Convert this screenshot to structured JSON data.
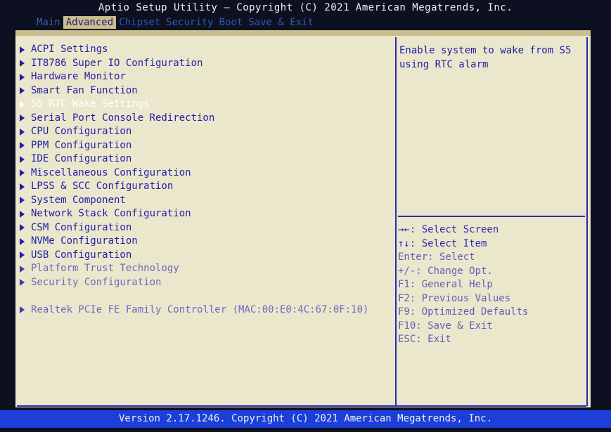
{
  "header": {
    "title": "Aptio Setup Utility – Copyright (C) 2021 American Megatrends, Inc."
  },
  "tabs": [
    {
      "label": "Main"
    },
    {
      "label": "Advanced",
      "active": true
    },
    {
      "label": "Chipset"
    },
    {
      "label": "Security"
    },
    {
      "label": "Boot"
    },
    {
      "label": "Save & Exit"
    }
  ],
  "menu": {
    "selected_index": 4,
    "items": [
      {
        "label": "ACPI Settings"
      },
      {
        "label": "IT8786 Super IO Configuration"
      },
      {
        "label": "Hardware Monitor"
      },
      {
        "label": "Smart Fan Function"
      },
      {
        "label": "S5 RTC Wake Settings"
      },
      {
        "label": "Serial Port Console Redirection"
      },
      {
        "label": "CPU Configuration"
      },
      {
        "label": "PPM Configuration"
      },
      {
        "label": "IDE Configuration"
      },
      {
        "label": "Miscellaneous Configuration"
      },
      {
        "label": "LPSS & SCC Configuration"
      },
      {
        "label": "System Component"
      },
      {
        "label": "Network Stack Configuration"
      },
      {
        "label": "CSM Configuration"
      },
      {
        "label": "NVMe Configuration"
      },
      {
        "label": "USB Configuration"
      },
      {
        "label": "Platform Trust Technology"
      },
      {
        "label": "Security Configuration"
      },
      {
        "label": "Realtek PCIe FE Family Controller (MAC:00:E0:4C:67:0F:10)"
      }
    ]
  },
  "help": {
    "text": "Enable system to wake from S5 using RTC alarm"
  },
  "keys": [
    {
      "label": "→←: Select Screen"
    },
    {
      "label": "↑↓: Select Item"
    },
    {
      "label": "Enter: Select"
    },
    {
      "label": "+/-: Change Opt."
    },
    {
      "label": "F1: General Help"
    },
    {
      "label": "F2: Previous Values"
    },
    {
      "label": "F9: Optimized Defaults"
    },
    {
      "label": "F10: Save & Exit"
    },
    {
      "label": "ESC: Exit"
    }
  ],
  "footer": {
    "text": "Version 2.17.1246. Copyright (C) 2021 American Megatrends, Inc."
  },
  "colors": {
    "panel_background": "#ebe7cc",
    "menu_text": "#1f1fa8",
    "selected_text": "#ffffff",
    "footer_bar": "#1b3fd8",
    "active_tab": "#c9bf8e"
  },
  "icons": {
    "menu_item": "triangle-right-icon"
  }
}
